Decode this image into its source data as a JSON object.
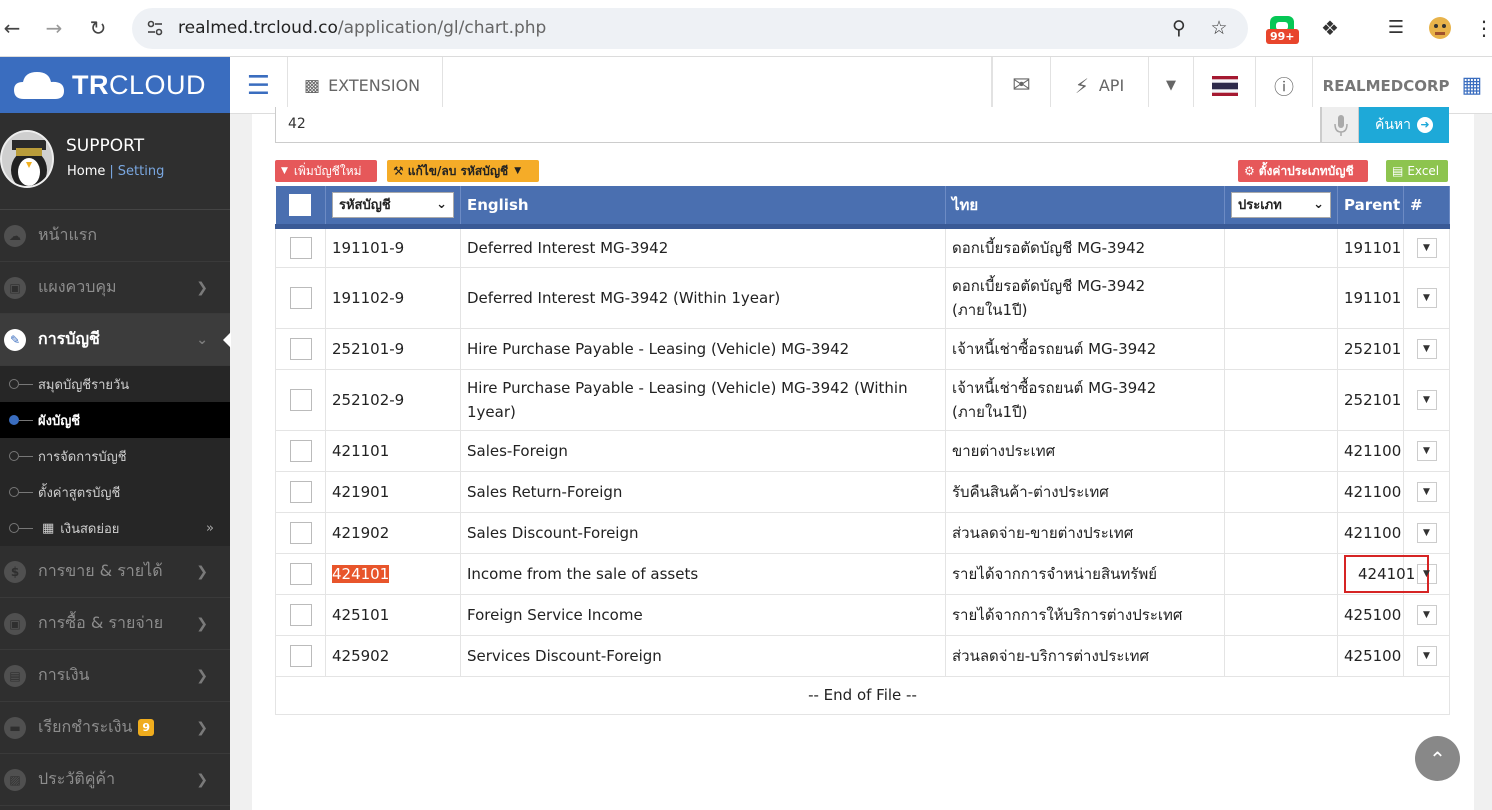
{
  "browser": {
    "url_domain": "realmed.trcloud.co",
    "url_path": "/application/gl/chart.php",
    "ext_badge": "99+"
  },
  "brand": {
    "logo_bold": "TR",
    "logo_regular": "CLOUD",
    "color": "#3a6dbf"
  },
  "profile": {
    "name": "SUPPORT",
    "home_label": "Home",
    "separator": "|",
    "setting_label": "Setting"
  },
  "sidebar": {
    "items": [
      {
        "label": "หน้าแรก",
        "icon": "cloud-icon"
      },
      {
        "label": "แผงควบคุม",
        "icon": "monitor-icon"
      },
      {
        "label": "การบัญชี",
        "icon": "book-icon",
        "active": true
      }
    ],
    "submenu": [
      {
        "label": "สมุดบัญชีรายวัน"
      },
      {
        "label": "ผังบัญชี",
        "active": true
      },
      {
        "label": "การจัดการบัญชี"
      },
      {
        "label": "ตั้งค่าสูตรบัญชี"
      },
      {
        "label": "เงินสดย่อย"
      }
    ],
    "items_after": [
      {
        "label": "การขาย & รายได้",
        "icon": "dollar-icon"
      },
      {
        "label": "การซื้อ & รายจ่าย",
        "icon": "cart-icon"
      },
      {
        "label": "การเงิน",
        "icon": "calendar-icon"
      },
      {
        "label": "เรียกชำระเงิน",
        "icon": "credit-card-icon",
        "badge": "9"
      },
      {
        "label": "ประวัติคู่ค้า",
        "icon": "contact-book-icon"
      }
    ]
  },
  "topbar": {
    "extension_label": "EXTENSION",
    "api_label": "API",
    "company_label": "REALMEDCORP"
  },
  "search": {
    "value": "42",
    "button_label": "ค้นหา"
  },
  "toolbar": {
    "add_label": "เพิ่มบัญชีใหม่",
    "edit_label": "แก้ไข/ลบ รหัสบัญชี",
    "type_label": "ตั้งค่าประเภทบัญชี",
    "excel_label": "Excel"
  },
  "table": {
    "headers": {
      "code_select": "รหัสบัญชี",
      "english": "English",
      "thai": "ไทย",
      "type_select": "ประเภท",
      "parent": "Parent",
      "menu": "#"
    },
    "rows": [
      {
        "code": "191101-9",
        "english": "Deferred Interest MG-3942",
        "thai": "ดอกเบี้ยรอตัดบัญชี MG-3942",
        "parent": "191101"
      },
      {
        "code": "191102-9",
        "english": "Deferred Interest MG-3942 (Within 1year)",
        "thai": "ดอกเบี้ยรอตัดบัญชี MG-3942 (ภายใน1ปี)",
        "parent": "191101"
      },
      {
        "code": "252101-9",
        "english": "Hire Purchase Payable - Leasing (Vehicle) MG-3942",
        "thai": "เจ้าหนี้เช่าซื้อรถยนต์ MG-3942",
        "parent": "252101"
      },
      {
        "code": "252102-9",
        "english": "Hire Purchase Payable - Leasing (Vehicle) MG-3942 (Within 1year)",
        "thai": "เจ้าหนี้เช่าซื้อรถยนต์ MG-3942 (ภายใน1ปี)",
        "parent": "252101"
      },
      {
        "code": "421101",
        "english": "Sales-Foreign",
        "thai": "ขายต่างประเทศ",
        "parent": "421100"
      },
      {
        "code": "421901",
        "english": "Sales Return-Foreign",
        "thai": "รับคืนสินค้า-ต่างประเทศ",
        "parent": "421100"
      },
      {
        "code": "421902",
        "english": "Sales Discount-Foreign",
        "thai": "ส่วนลดจ่าย-ขายต่างประเทศ",
        "parent": "421100"
      },
      {
        "code": "424101",
        "english": "Income from the sale of assets",
        "thai": "รายได้จากการจำหน่ายสินทรัพย์",
        "parent": "424101",
        "highlight": true
      },
      {
        "code": "425101",
        "english": "Foreign Service Income",
        "thai": "รายได้จากการให้บริการต่างประเทศ",
        "parent": "425100"
      },
      {
        "code": "425902",
        "english": "Services Discount-Foreign",
        "thai": "ส่วนลดจ่าย-บริการต่างประเทศ",
        "parent": "425100"
      }
    ],
    "end_text": "-- End of File --"
  }
}
